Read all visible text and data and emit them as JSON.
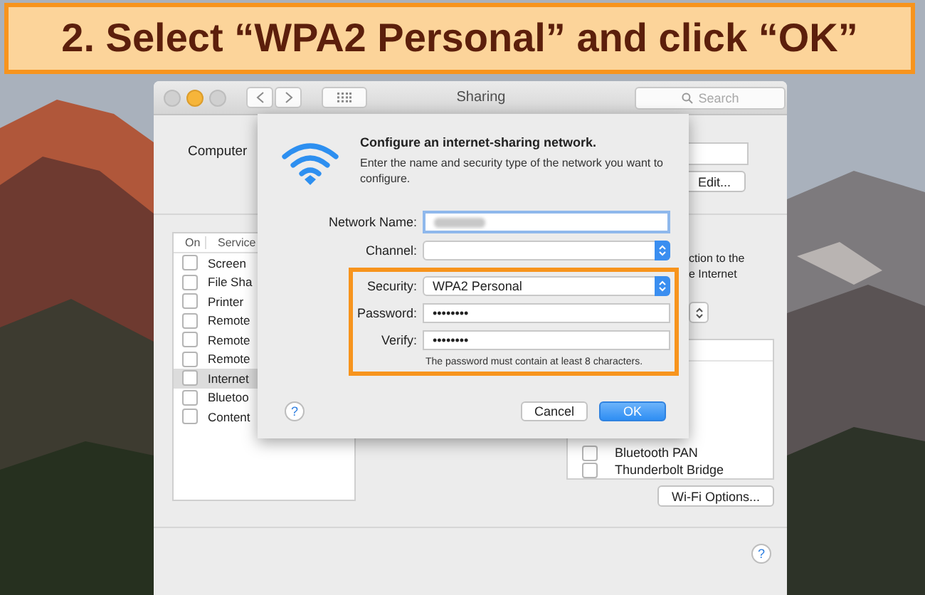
{
  "banner": {
    "text": "2. Select “WPA2 Personal” and click “OK”"
  },
  "window": {
    "title": "Sharing",
    "search": {
      "placeholder": "Search"
    }
  },
  "computer_name": {
    "label": "Computer",
    "edit_button": "Edit..."
  },
  "services": {
    "columns": [
      "On",
      "Service"
    ],
    "rows": [
      {
        "name": "Screen",
        "checked": false,
        "selected": false
      },
      {
        "name": "File Sha",
        "checked": false,
        "selected": false
      },
      {
        "name": "Printer",
        "checked": false,
        "selected": false
      },
      {
        "name": "Remote",
        "checked": false,
        "selected": false
      },
      {
        "name": "Remote",
        "checked": false,
        "selected": false
      },
      {
        "name": "Remote",
        "checked": false,
        "selected": false
      },
      {
        "name": "Internet",
        "checked": false,
        "selected": true
      },
      {
        "name": "Bluetoo",
        "checked": false,
        "selected": false
      },
      {
        "name": "Content",
        "checked": false,
        "selected": false
      }
    ]
  },
  "description": [
    "ction to the",
    "e Internet"
  ],
  "ports": {
    "rows": [
      {
        "name": "Bluetooth PAN",
        "checked": false
      },
      {
        "name": "Thunderbolt Bridge",
        "checked": false
      }
    ]
  },
  "wifi_options_button": "Wi-Fi Options...",
  "help_button": "?",
  "sheet": {
    "title": "Configure an internet-sharing network.",
    "description": "Enter the name and security type of the network you want to configure.",
    "fields": [
      {
        "label": "Network Name:",
        "kind": "redacted"
      },
      {
        "label": "Channel:",
        "kind": "popup"
      }
    ],
    "highlighted": {
      "fields": [
        {
          "label": "Security:",
          "kind": "popup",
          "value": "WPA2 Personal"
        },
        {
          "label": "Password:",
          "kind": "secure",
          "value": "••••••••"
        },
        {
          "label": "Verify:",
          "kind": "secure",
          "value": "••••••••"
        }
      ],
      "hint": "The password must contain at least 8 characters."
    },
    "help_button": "?",
    "buttons": [
      {
        "label": "Cancel",
        "default": false
      },
      {
        "label": "OK",
        "default": true
      }
    ]
  }
}
